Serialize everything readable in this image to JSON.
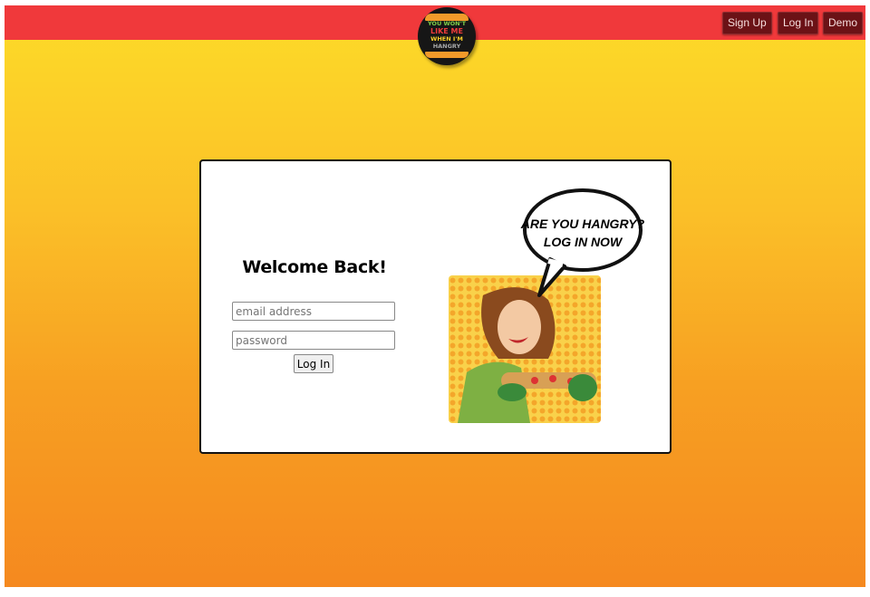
{
  "header": {
    "logo_lines": [
      "YOU WON'T",
      "LIKE ME",
      "WHEN I'M",
      "HANGRY"
    ],
    "nav": [
      {
        "label": "Sign Up"
      },
      {
        "label": "Log In"
      },
      {
        "label": "Demo"
      }
    ]
  },
  "login": {
    "title": "Welcome Back!",
    "email_placeholder": "email address",
    "password_placeholder": "password",
    "submit_label": "Log In"
  },
  "illustration": {
    "bubble_line1": "ARE YOU HANGRY?",
    "bubble_line2": "LOG IN NOW"
  },
  "colors": {
    "header": "#f0393b",
    "nav_button": "#6b1216"
  }
}
